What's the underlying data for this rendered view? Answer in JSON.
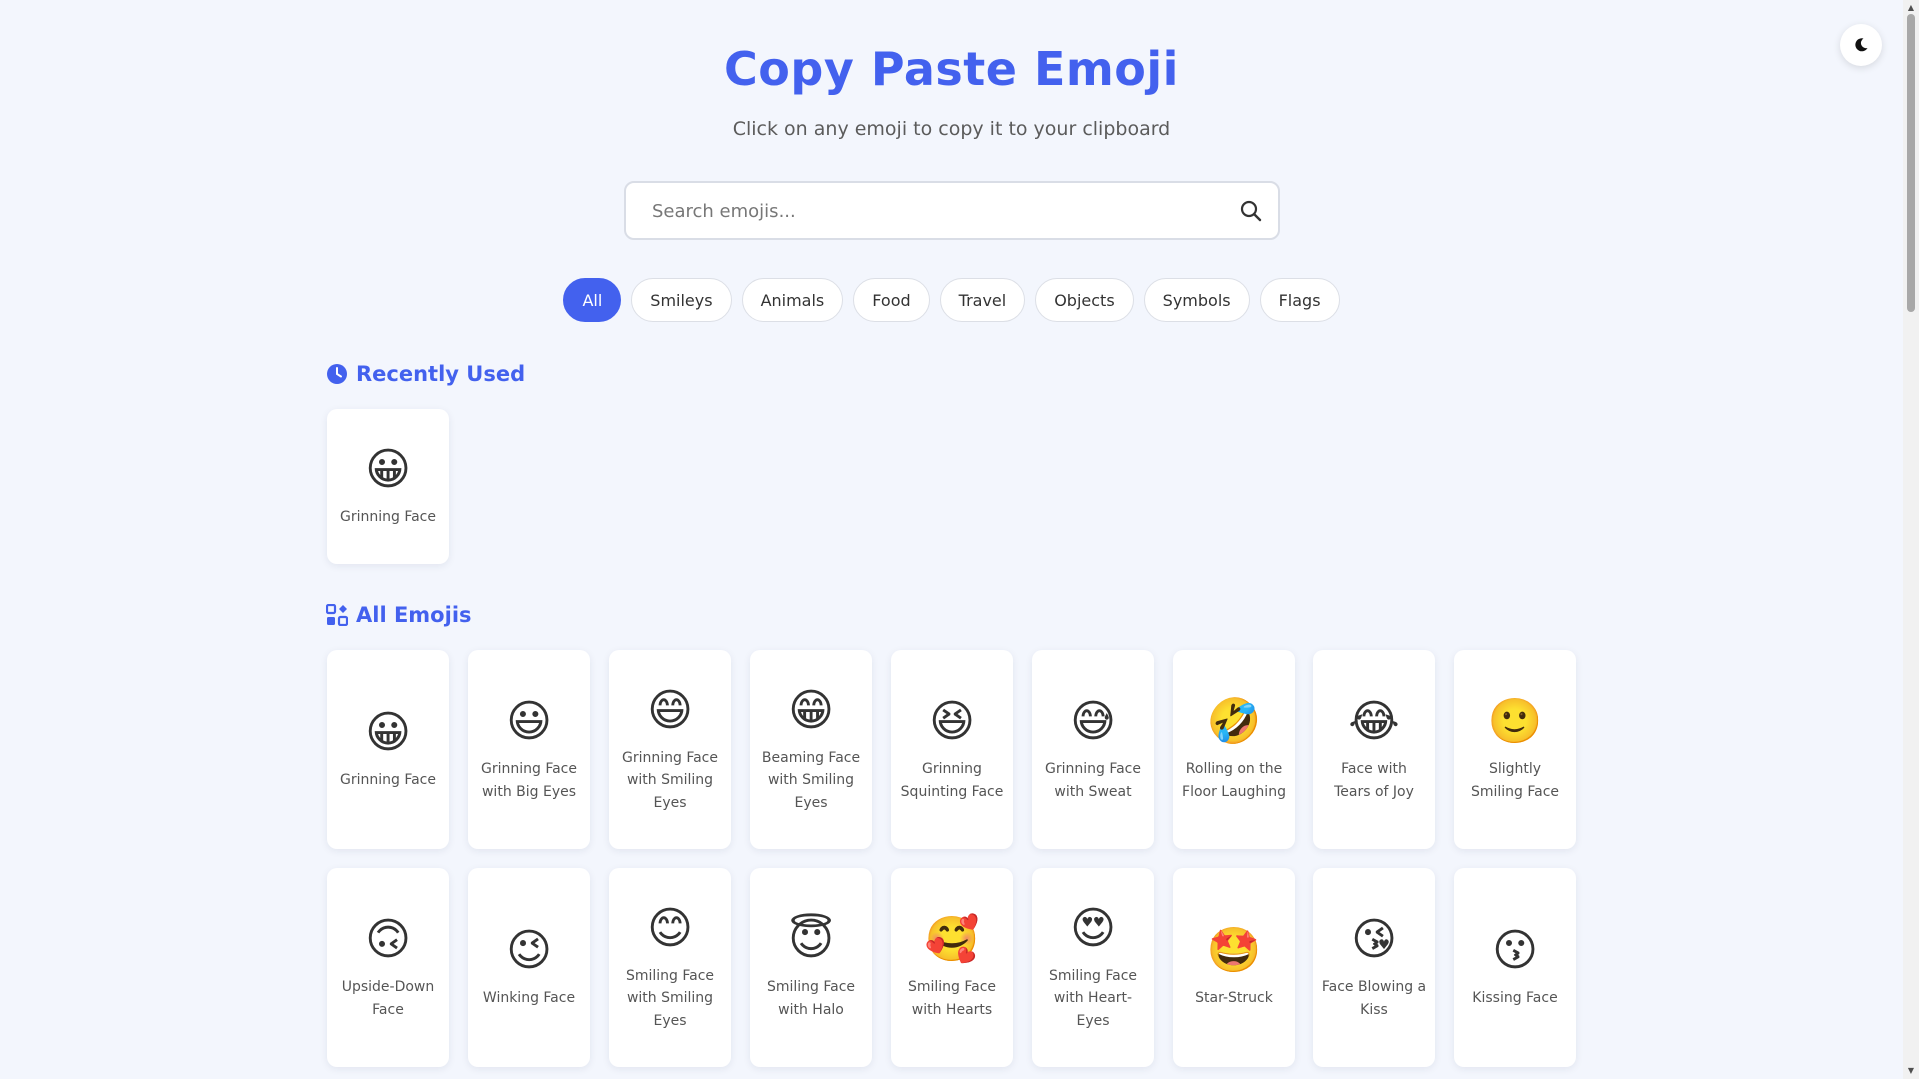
{
  "header": {
    "title": "Copy Paste Emoji",
    "subtitle": "Click on any emoji to copy it to your clipboard"
  },
  "theme_toggle": {
    "icon": "moon-icon"
  },
  "search": {
    "placeholder": "Search emojis...",
    "value": "",
    "icon": "search-icon"
  },
  "categories": [
    {
      "label": "All",
      "active": true
    },
    {
      "label": "Smileys",
      "active": false
    },
    {
      "label": "Animals",
      "active": false
    },
    {
      "label": "Food",
      "active": false
    },
    {
      "label": "Travel",
      "active": false
    },
    {
      "label": "Objects",
      "active": false
    },
    {
      "label": "Symbols",
      "active": false
    },
    {
      "label": "Flags",
      "active": false
    }
  ],
  "recent": {
    "title": "Recently Used",
    "icon": "clock-icon",
    "items": [
      {
        "emoji": "😀",
        "label": "Grinning Face"
      }
    ]
  },
  "all": {
    "title": "All Emojis",
    "icon": "grid-icon",
    "items": [
      {
        "emoji": "😀",
        "label": "Grinning Face"
      },
      {
        "emoji": "😃",
        "label": "Grinning Face with Big Eyes"
      },
      {
        "emoji": "😄",
        "label": "Grinning Face with Smiling Eyes"
      },
      {
        "emoji": "😁",
        "label": "Beaming Face with Smiling Eyes"
      },
      {
        "emoji": "😆",
        "label": "Grinning Squinting Face"
      },
      {
        "emoji": "😅",
        "label": "Grinning Face with Sweat"
      },
      {
        "emoji": "🤣",
        "label": "Rolling on the Floor Laughing"
      },
      {
        "emoji": "😂",
        "label": "Face with Tears of Joy"
      },
      {
        "emoji": "🙂",
        "label": "Slightly Smiling Face"
      },
      {
        "emoji": "🙃",
        "label": "Upside-Down Face"
      },
      {
        "emoji": "😉",
        "label": "Winking Face"
      },
      {
        "emoji": "😊",
        "label": "Smiling Face with Smiling Eyes"
      },
      {
        "emoji": "😇",
        "label": "Smiling Face with Halo"
      },
      {
        "emoji": "🥰",
        "label": "Smiling Face with Hearts"
      },
      {
        "emoji": "😍",
        "label": "Smiling Face with Heart-Eyes"
      },
      {
        "emoji": "🤩",
        "label": "Star-Struck"
      },
      {
        "emoji": "😘",
        "label": "Face Blowing a Kiss"
      },
      {
        "emoji": "😗",
        "label": "Kissing Face"
      }
    ]
  }
}
